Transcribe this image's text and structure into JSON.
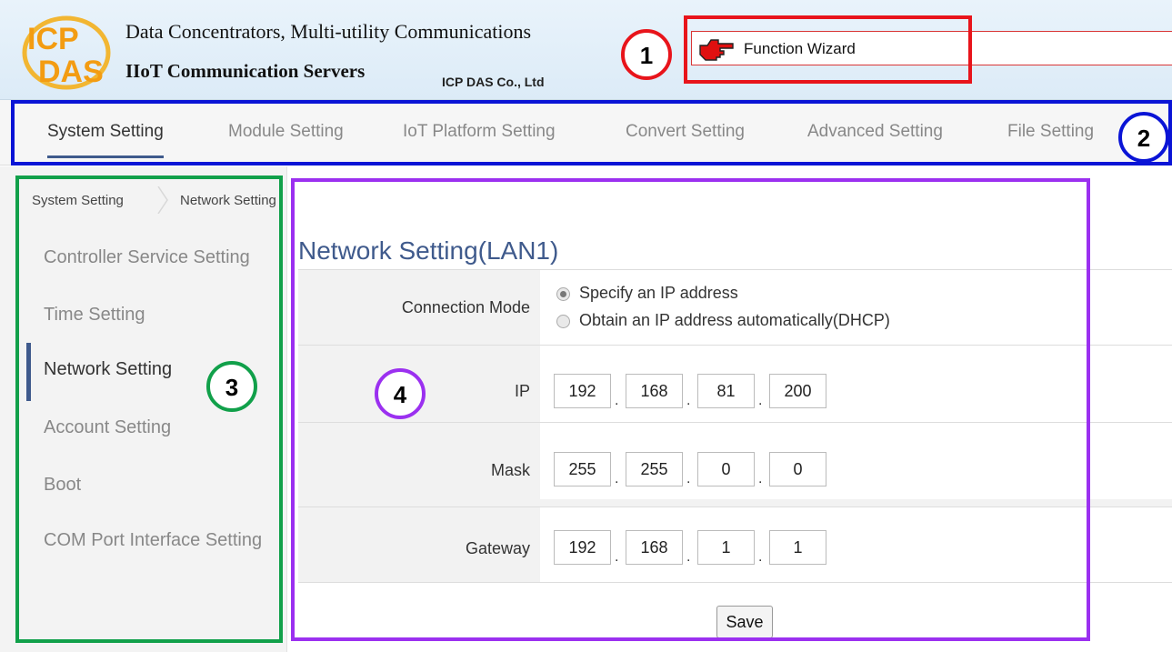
{
  "header": {
    "brand_line1": "Data Concentrators, Multi-utility Communications",
    "brand_line2": "IIoT Communication Servers",
    "company": "ICP DAS Co., Ltd",
    "wizard_label": "Function Wizard"
  },
  "nav": {
    "tabs": [
      {
        "label": "System Setting",
        "active": true
      },
      {
        "label": "Module Setting"
      },
      {
        "label": "IoT Platform Setting"
      },
      {
        "label": "Convert Setting"
      },
      {
        "label": "Advanced Setting"
      },
      {
        "label": "File Setting"
      }
    ]
  },
  "breadcrumb": [
    "System Setting",
    "Network Setting"
  ],
  "sidebar": {
    "items": [
      {
        "label": "Controller Service Setting"
      },
      {
        "label": "Time Setting"
      },
      {
        "label": "Network Setting",
        "active": true
      },
      {
        "label": "Account Setting"
      },
      {
        "label": "Boot"
      },
      {
        "label": "COM Port Interface Setting"
      }
    ]
  },
  "main": {
    "title": "Network Setting(LAN1)",
    "connection_mode": {
      "label": "Connection Mode",
      "options": [
        {
          "label": "Specify an IP address",
          "selected": true
        },
        {
          "label": "Obtain an IP address automatically(DHCP)",
          "selected": false
        }
      ]
    },
    "ip": {
      "label": "IP",
      "octets": [
        "192",
        "168",
        "81",
        "200"
      ]
    },
    "mask": {
      "label": "Mask",
      "octets": [
        "255",
        "255",
        "0",
        "0"
      ]
    },
    "gateway": {
      "label": "Gateway",
      "octets": [
        "192",
        "168",
        "1",
        "1"
      ]
    },
    "save_label": "Save"
  },
  "annotations": {
    "labels": [
      "1",
      "2",
      "3",
      "4"
    ],
    "colors": {
      "1": "#e8141b",
      "2": "#0a14d6",
      "3": "#11a04a",
      "4": "#9b30f0"
    }
  },
  "colors": {
    "accent": "#3f5a8c",
    "header_bg": "#e3eff9",
    "wizard_icon": "#e01010"
  }
}
